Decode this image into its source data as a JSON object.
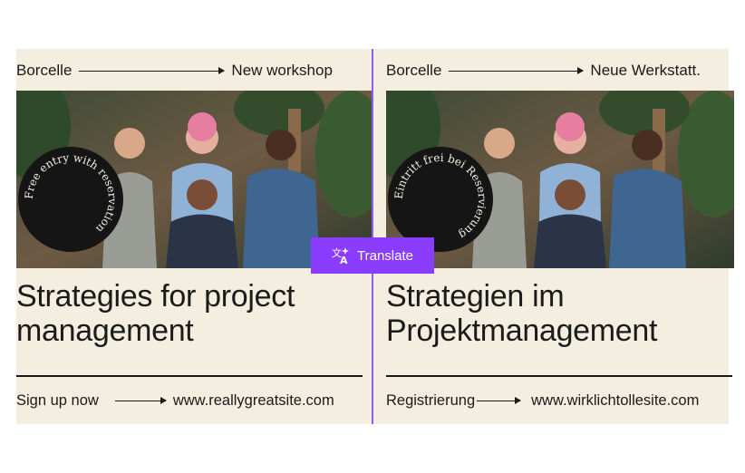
{
  "english": {
    "brand": "Borcelle",
    "tag": "New workshop",
    "stamp_text": "Free entry with reservation",
    "headline_line1": "Strategies for project",
    "headline_line2": "management",
    "cta": "Sign up now",
    "url": "www.reallygreatsite.com"
  },
  "german": {
    "brand": "Borcelle",
    "tag": "Neue Werkstatt.",
    "stamp_text": "Eintritt frei bei Reservierung",
    "headline_line1": "Strategien im",
    "headline_line2": "Projektmanagement",
    "cta": "Registrierung",
    "url": "www.wirklichtollesite.com"
  },
  "translate_button": {
    "label": "Translate",
    "icon": "translate-icon",
    "color": "#8b3dff"
  },
  "colors": {
    "panel_bg": "#f4eee0",
    "divider": "#8b5cf6",
    "text": "#1a1a1a"
  }
}
